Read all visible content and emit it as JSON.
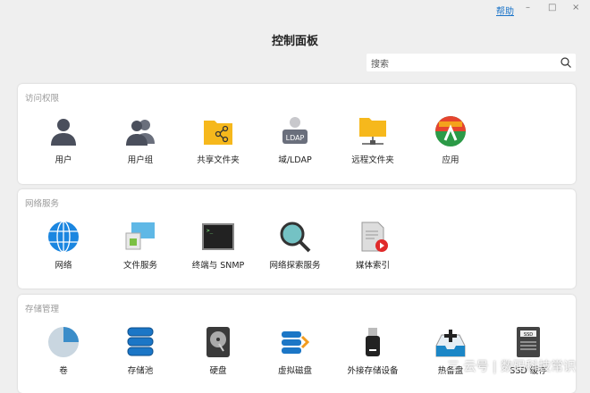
{
  "window": {
    "help": "帮助",
    "minimize": "–",
    "maximize": "□",
    "close": "×",
    "title": "控制面板"
  },
  "search": {
    "placeholder": "搜索"
  },
  "sections": [
    {
      "title": "访问权限",
      "items": [
        {
          "label": "用户",
          "icon": "user-icon"
        },
        {
          "label": "用户组",
          "icon": "user-group-icon"
        },
        {
          "label": "共享文件夹",
          "icon": "shared-folder-icon"
        },
        {
          "label": "域/LDAP",
          "icon": "ldap-icon"
        },
        {
          "label": "远程文件夹",
          "icon": "remote-folder-icon"
        },
        {
          "label": "应用",
          "icon": "app-icon"
        }
      ]
    },
    {
      "title": "网络服务",
      "items": [
        {
          "label": "网络",
          "icon": "globe-icon"
        },
        {
          "label": "文件服务",
          "icon": "file-service-icon"
        },
        {
          "label": "终端与 SNMP",
          "icon": "terminal-icon"
        },
        {
          "label": "网络探索服务",
          "icon": "magnifier-icon"
        },
        {
          "label": "媒体索引",
          "icon": "media-index-icon"
        }
      ]
    },
    {
      "title": "存储管理",
      "items": [
        {
          "label": "卷",
          "icon": "volume-pie-icon"
        },
        {
          "label": "存储池",
          "icon": "storage-pool-icon"
        },
        {
          "label": "硬盘",
          "icon": "hard-disk-icon"
        },
        {
          "label": "虚拟磁盘",
          "icon": "virtual-disk-icon"
        },
        {
          "label": "外接存储设备",
          "icon": "usb-drive-icon"
        },
        {
          "label": "热备盘",
          "icon": "hot-spare-icon"
        },
        {
          "label": "SSD 缓存",
          "icon": "ssd-icon"
        }
      ]
    }
  ],
  "watermark": "三 云号 | 数码科技常识"
}
